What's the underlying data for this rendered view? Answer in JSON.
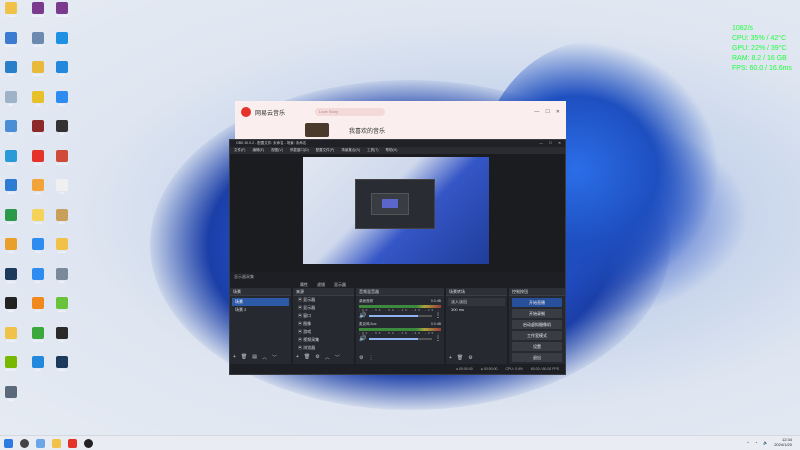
{
  "overlay": {
    "lines": [
      "1082/s",
      "CPU: 35% / 42°C",
      "GPU: 22% / 39°C",
      "RAM: 8.2 / 16 GB",
      "FPS: 60.0 / 16.6ms"
    ]
  },
  "desktop_icons": [
    {
      "label": "Folder",
      "color": "#f0c24a"
    },
    {
      "label": "WinRAR",
      "color": "#7a3b8e"
    },
    {
      "label": "WinRAR",
      "color": "#7a3b8e"
    },
    {
      "label": "Monitor",
      "color": "#3b7bd1"
    },
    {
      "label": "Phone",
      "color": "#6c8ab0"
    },
    {
      "label": "App",
      "color": "#1e90e6"
    },
    {
      "label": "Tool",
      "color": "#2a7fc9"
    },
    {
      "label": "Chrome",
      "color": "#e8b93a"
    },
    {
      "label": "App",
      "color": "#2188dd"
    },
    {
      "label": "Bin",
      "color": "#9fb3c8"
    },
    {
      "label": "App",
      "color": "#e8c02a"
    },
    {
      "label": "Play",
      "color": "#2e8bf0"
    },
    {
      "label": "PC",
      "color": "#4a8fd6"
    },
    {
      "label": "Game",
      "color": "#8c2a2a"
    },
    {
      "label": "QR",
      "color": "#333333"
    },
    {
      "label": "Edge",
      "color": "#2b9bd8"
    },
    {
      "label": "Music",
      "color": "#e5332a"
    },
    {
      "label": "Calendar",
      "color": "#d04a3a"
    },
    {
      "label": "Store",
      "color": "#2d7cd4"
    },
    {
      "label": "App",
      "color": "#f2a33a"
    },
    {
      "label": "File",
      "color": "#f0f0f0"
    },
    {
      "label": "Globe",
      "color": "#2a9a4a"
    },
    {
      "label": "Hand",
      "color": "#f5d35a"
    },
    {
      "label": "Box",
      "color": "#c9a05a"
    },
    {
      "label": "App",
      "color": "#e8a02a"
    },
    {
      "label": "Play",
      "color": "#2e8bf0"
    },
    {
      "label": "Folder",
      "color": "#f0c24a"
    },
    {
      "label": "Steam",
      "color": "#1c3a5c"
    },
    {
      "label": "Play",
      "color": "#2e8bf0"
    },
    {
      "label": "Ship",
      "color": "#7a8a9a"
    },
    {
      "label": "OBS",
      "color": "#222222"
    },
    {
      "label": "VLC",
      "color": "#f08a1e"
    },
    {
      "label": "Game",
      "color": "#68c23a"
    },
    {
      "label": "Folder",
      "color": "#f0c24a"
    },
    {
      "label": "WeChat",
      "color": "#3aa83a"
    },
    {
      "label": "Star",
      "color": "#2a2a2a"
    },
    {
      "label": "NVIDIA",
      "color": "#76b900"
    },
    {
      "label": "App",
      "color": "#2188dd"
    },
    {
      "label": "Steam",
      "color": "#1c3a5c"
    },
    {
      "label": "Char",
      "color": "#5a6a7a"
    }
  ],
  "music": {
    "app_name": "网易云音乐",
    "search_placeholder": "Love Story",
    "song": "我喜欢的音乐",
    "accent": "#e5332a"
  },
  "obs": {
    "title": "OBS 30.0.2 - 配置文件: 未命名 - 场景: 未命名",
    "menu": [
      "文件(F)",
      "编辑(E)",
      "视图(V)",
      "停靠窗口(D)",
      "配置文件(P)",
      "场景集合(S)",
      "工具(T)",
      "帮助(H)"
    ],
    "source_label": "显示器采集",
    "source_btns": [
      "属性",
      "滤镜",
      "显示器"
    ],
    "scenes_header": "场景",
    "scenes": [
      "场景",
      "场景 2"
    ],
    "sources_header": "来源",
    "sources": [
      "显示器",
      "显示器",
      "窗口",
      "图像",
      "游戏",
      "视频采集",
      "浏览器"
    ],
    "mixer_header": "音频混音器",
    "mixer_channels": [
      {
        "name": "桌面音频",
        "value": "0.0 dB",
        "level": 0.78
      },
      {
        "name": "麦克风/Aux",
        "value": "0.0 dB",
        "level": 0.78
      }
    ],
    "scale": "-60 -55 -50 -45 -40 -35 -30 -25 -20 -15 -10 -5 0",
    "transitions_header": "场景转场",
    "transition": "淡入淡出",
    "duration": "300 ms",
    "controls_header": "控制按钮",
    "controls": [
      "开始直播",
      "开始录制",
      "启动虚拟摄像机",
      "工作室模式",
      "设置",
      "退出"
    ],
    "status": [
      "● 00:00:00",
      "● 00:00:00",
      "CPU: 0.4%",
      "60.00 / 60.00 FPS"
    ]
  },
  "taskbar": {
    "time": "12:34",
    "date": "2024/1/20"
  }
}
